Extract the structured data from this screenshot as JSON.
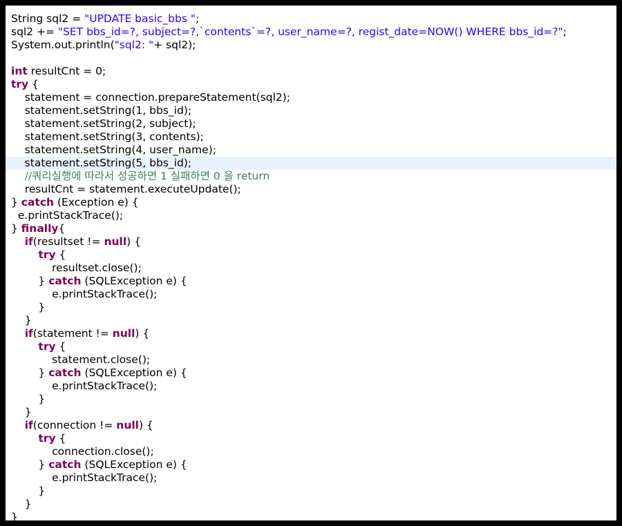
{
  "colors": {
    "keyword": "#7f0055",
    "string": "#2a00ff",
    "comment": "#3f7f5f",
    "text": "#000000",
    "highlight": "#e8f2fe",
    "frame": "#000000"
  },
  "highlighted_line": 12,
  "lines": [
    [
      {
        "t": "p",
        "v": "String sql2 = "
      },
      {
        "t": "s",
        "v": "\"UPDATE basic_bbs \""
      },
      {
        "t": "p",
        "v": ";"
      }
    ],
    [
      {
        "t": "p",
        "v": "sql2 += "
      },
      {
        "t": "s",
        "v": "\"SET bbs_id=?, subject=?,`contents`=?, user_name=?, regist_date=NOW() WHERE bbs_id=?\""
      },
      {
        "t": "p",
        "v": ";"
      }
    ],
    [
      {
        "t": "p",
        "v": "System.out.println("
      },
      {
        "t": "s",
        "v": "\"sql2: \""
      },
      {
        "t": "p",
        "v": "+ sql2);"
      }
    ],
    [],
    [
      {
        "t": "k",
        "v": "int"
      },
      {
        "t": "p",
        "v": " resultCnt = 0;"
      }
    ],
    [
      {
        "t": "k",
        "v": "try"
      },
      {
        "t": "p",
        "v": " {"
      }
    ],
    [
      {
        "t": "p",
        "v": "    statement = connection.prepareStatement(sql2);"
      }
    ],
    [
      {
        "t": "p",
        "v": "    statement.setString(1, bbs_id);"
      }
    ],
    [
      {
        "t": "p",
        "v": "    statement.setString(2, subject);"
      }
    ],
    [
      {
        "t": "p",
        "v": "    statement.setString(3, contents);"
      }
    ],
    [
      {
        "t": "p",
        "v": "    statement.setString(4, user_name);"
      }
    ],
    [
      {
        "t": "p",
        "v": "    statement.setString(5, bbs_id);"
      }
    ],
    [
      {
        "t": "c",
        "v": "    //쿼리실행에 따라서 성공하면 1 실패하면 0 을 return"
      }
    ],
    [
      {
        "t": "p",
        "v": "    resultCnt = statement.executeUpdate();"
      }
    ],
    [
      {
        "t": "p",
        "v": "} "
      },
      {
        "t": "k",
        "v": "catch"
      },
      {
        "t": "p",
        "v": " (Exception e) {"
      }
    ],
    [
      {
        "t": "p",
        "v": "  e.printStackTrace();"
      }
    ],
    [
      {
        "t": "p",
        "v": "} "
      },
      {
        "t": "k",
        "v": "finally"
      },
      {
        "t": "p",
        "v": "{"
      }
    ],
    [
      {
        "t": "p",
        "v": "    "
      },
      {
        "t": "k",
        "v": "if"
      },
      {
        "t": "p",
        "v": "(resultset != "
      },
      {
        "t": "k",
        "v": "null"
      },
      {
        "t": "p",
        "v": ") {"
      }
    ],
    [
      {
        "t": "p",
        "v": "        "
      },
      {
        "t": "k",
        "v": "try"
      },
      {
        "t": "p",
        "v": " {"
      }
    ],
    [
      {
        "t": "p",
        "v": "            resultset.close();"
      }
    ],
    [
      {
        "t": "p",
        "v": "        } "
      },
      {
        "t": "k",
        "v": "catch"
      },
      {
        "t": "p",
        "v": " (SQLException e) {"
      }
    ],
    [
      {
        "t": "p",
        "v": "            e.printStackTrace();"
      }
    ],
    [
      {
        "t": "p",
        "v": "        }"
      }
    ],
    [
      {
        "t": "p",
        "v": "    }"
      }
    ],
    [
      {
        "t": "p",
        "v": "    "
      },
      {
        "t": "k",
        "v": "if"
      },
      {
        "t": "p",
        "v": "(statement != "
      },
      {
        "t": "k",
        "v": "null"
      },
      {
        "t": "p",
        "v": ") {"
      }
    ],
    [
      {
        "t": "p",
        "v": "        "
      },
      {
        "t": "k",
        "v": "try"
      },
      {
        "t": "p",
        "v": " {"
      }
    ],
    [
      {
        "t": "p",
        "v": "            statement.close();"
      }
    ],
    [
      {
        "t": "p",
        "v": "        } "
      },
      {
        "t": "k",
        "v": "catch"
      },
      {
        "t": "p",
        "v": " (SQLException e) {"
      }
    ],
    [
      {
        "t": "p",
        "v": "            e.printStackTrace();"
      }
    ],
    [
      {
        "t": "p",
        "v": "        }"
      }
    ],
    [
      {
        "t": "p",
        "v": "    }"
      }
    ],
    [
      {
        "t": "p",
        "v": "    "
      },
      {
        "t": "k",
        "v": "if"
      },
      {
        "t": "p",
        "v": "(connection != "
      },
      {
        "t": "k",
        "v": "null"
      },
      {
        "t": "p",
        "v": ") {"
      }
    ],
    [
      {
        "t": "p",
        "v": "        "
      },
      {
        "t": "k",
        "v": "try"
      },
      {
        "t": "p",
        "v": " {"
      }
    ],
    [
      {
        "t": "p",
        "v": "            connection.close();"
      }
    ],
    [
      {
        "t": "p",
        "v": "        } "
      },
      {
        "t": "k",
        "v": "catch"
      },
      {
        "t": "p",
        "v": " (SQLException e) {"
      }
    ],
    [
      {
        "t": "p",
        "v": "            e.printStackTrace();"
      }
    ],
    [
      {
        "t": "p",
        "v": "        }"
      }
    ],
    [
      {
        "t": "p",
        "v": "    }"
      }
    ],
    [
      {
        "t": "p",
        "v": "}"
      }
    ]
  ]
}
